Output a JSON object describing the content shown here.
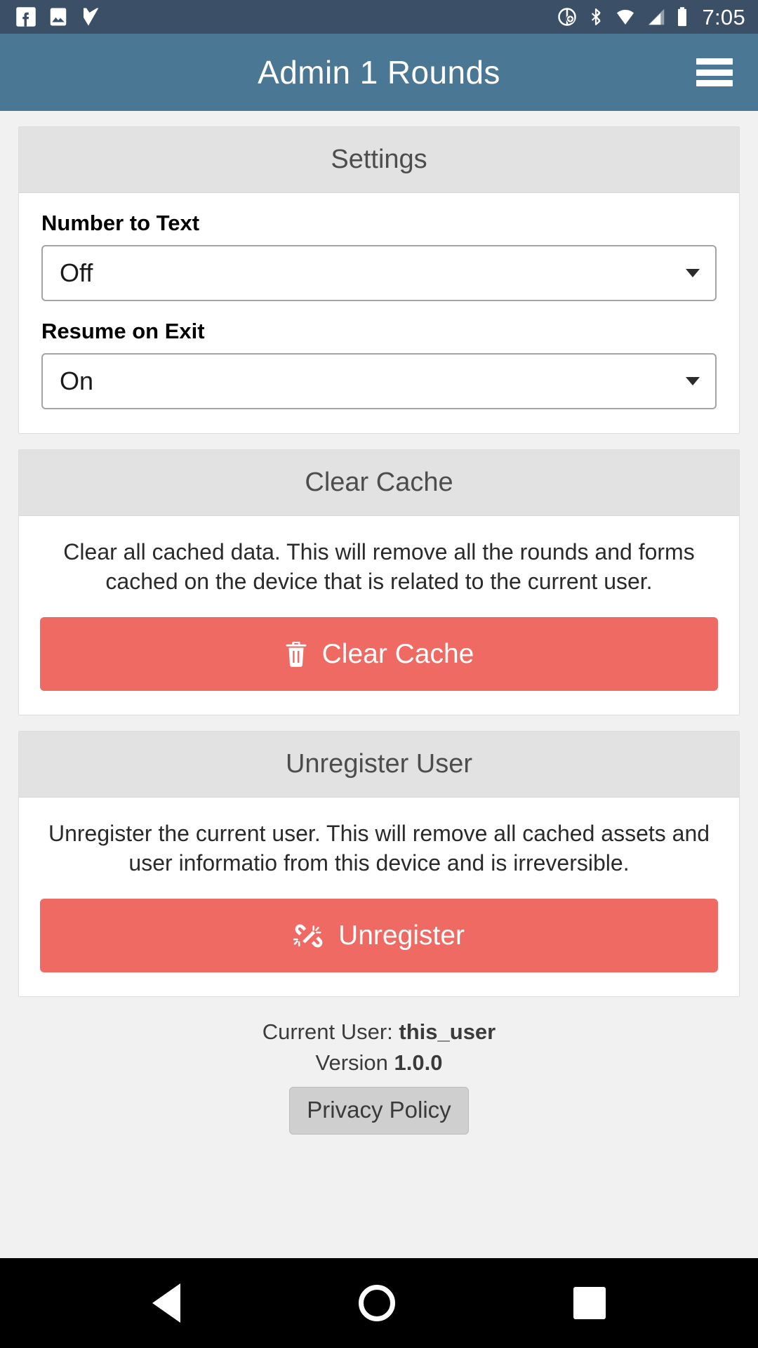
{
  "status_bar": {
    "icons_left": [
      "facebook-icon",
      "gallery-image-icon",
      "checkmark-flag-icon"
    ],
    "icons_right": [
      "location-add-icon",
      "bluetooth-icon",
      "wifi-icon",
      "cellular-signal-icon",
      "battery-icon"
    ],
    "clock": "7:05",
    "background_color": "#3b5066"
  },
  "app_bar": {
    "title": "Admin 1 Rounds",
    "menu_icon": "hamburger-menu-icon",
    "background_color": "#4a7794"
  },
  "settings_panel": {
    "heading": "Settings",
    "fields": [
      {
        "label": "Number to Text",
        "value": "Off"
      },
      {
        "label": "Resume on Exit",
        "value": "On"
      }
    ]
  },
  "clear_cache_panel": {
    "heading": "Clear Cache",
    "description": "Clear all cached data. This will remove all the rounds and forms cached on the device that is related to the current user.",
    "button_label": "Clear Cache",
    "button_icon": "trash-icon",
    "button_color": "#ef6a63"
  },
  "unregister_panel": {
    "heading": "Unregister User",
    "description": "Unregister the current user. This will remove all cached assets and user informatio from this device and is irreversible.",
    "button_label": "Unregister",
    "button_icon": "broken-link-icon",
    "button_color": "#ef6a63"
  },
  "footer": {
    "current_user_label": "Current User:",
    "current_user_value": "this_user",
    "version_label": "Version",
    "version_value": "1.0.0",
    "privacy_button_label": "Privacy Policy"
  },
  "nav_bar": {
    "back": "back-triangle-icon",
    "home": "home-circle-icon",
    "recents": "recents-square-icon"
  }
}
